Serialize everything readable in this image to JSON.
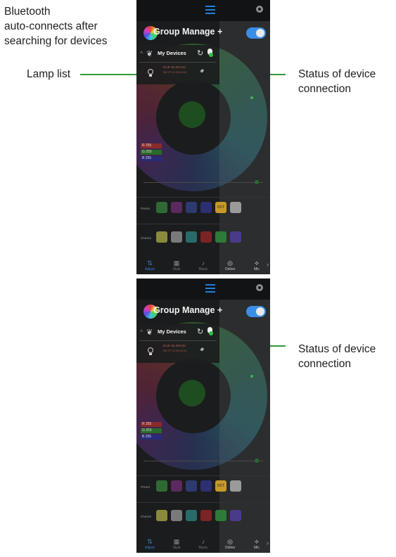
{
  "annotations": {
    "top_left_lines": [
      "Bluetooth",
      "auto-connects after",
      "searching for devices"
    ],
    "lamp_list": "Lamp list",
    "status_lines": [
      "Status of device",
      "connection"
    ]
  },
  "colors": {
    "accent_line": "#2f9a3a",
    "toggle_on": "#3b8ee5",
    "active_tab": "#3a7fd0"
  },
  "screens": [
    {
      "group_title": "Group Manage",
      "add_symbol": "+",
      "my_devices_label": "My Devices",
      "device_name": "DUE-BLEDOM",
      "device_mac": "BE:FF:11:09:93:24",
      "rgb": [
        "R 255",
        "G 255",
        "B 255"
      ],
      "preset_label": "Preset",
      "preset_tag": "OCT",
      "check_label": "Checks",
      "tabs": [
        "Adjust",
        "Style",
        "Music",
        "Online",
        "Mic"
      ]
    },
    {
      "group_title": "Group Manage",
      "add_symbol": "+",
      "my_devices_label": "My Devices",
      "device_name": "DUE-BLEDOM",
      "device_mac": "BE:FF:11:09:93:24",
      "rgb": [
        "R 255",
        "G 255",
        "B 255"
      ],
      "preset_label": "Preset",
      "preset_tag": "OCT",
      "check_label": "Checks",
      "tabs": [
        "Adjust",
        "Style",
        "Music",
        "Online",
        "Mic"
      ]
    }
  ]
}
